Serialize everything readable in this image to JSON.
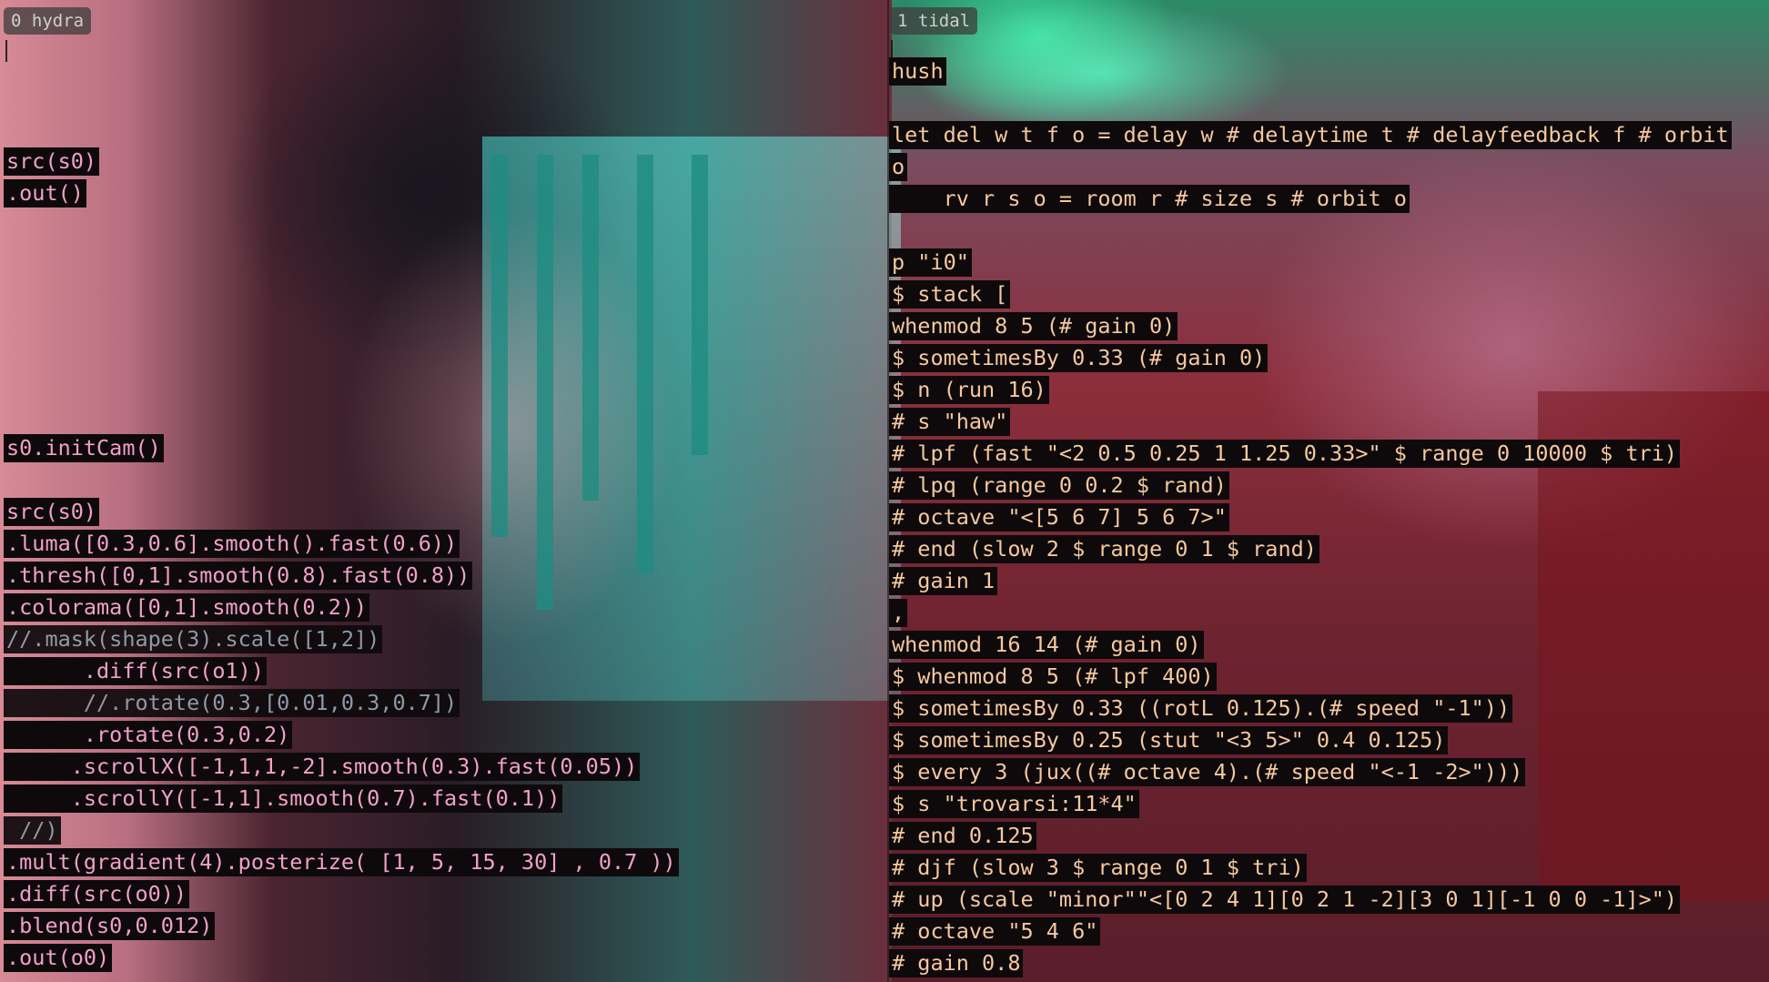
{
  "tabs": {
    "left": "0 hydra",
    "right": "1 tidal"
  },
  "colors": {
    "hydra_code": "#f2a0c8",
    "tidal_code": "#f6c89e",
    "comment": "#8f9aa6",
    "line_background": "#0e0a0c"
  },
  "hydra": {
    "lines": [
      "src(s0)",
      ".out()",
      "s0.initCam()",
      "src(s0)",
      ".luma([0.3,0.6].smooth().fast(0.6))",
      ".thresh([0,1].smooth(0.8).fast(0.8))",
      ".colorama([0,1].smooth(0.2))",
      "//.mask(shape(3).scale([1,2])",
      "      .diff(src(o1))",
      "      //.rotate(0.3,[0.01,0.3,0.7])",
      "      .rotate(0.3,0.2)",
      "     .scrollX([-1,1,1,-2].smooth(0.3).fast(0.05))",
      "     .scrollY([-1,1].smooth(0.7).fast(0.1))",
      " //)",
      ".mult(gradient(4).posterize( [1, 5, 15, 30] , 0.7 ))",
      ".diff(src(o0))",
      ".blend(s0,0.012)",
      ".out(o0)"
    ]
  },
  "tidal": {
    "lines": [
      "hush",
      "let del w t f o = delay w # delaytime t # delayfeedback f # orbit",
      "o",
      "    rv r s o = room r # size s # orbit o",
      "p \"i0\"",
      "$ stack [",
      "whenmod 8 5 (# gain 0)",
      "$ sometimesBy 0.33 (# gain 0)",
      "$ n (run 16)",
      "# s \"haw\"",
      "# lpf (fast \"<2 0.5 0.25 1 1.25 0.33>\" $ range 0 10000 $ tri)",
      "# lpq (range 0 0.2 $ rand)",
      "# octave \"<[5 6 7] 5 6 7>\"",
      "# end (slow 2 $ range 0 1 $ rand)",
      "# gain 1",
      ",",
      "whenmod 16 14 (# gain 0)",
      "$ whenmod 8 5 (# lpf 400)",
      "$ sometimesBy 0.33 ((rotL 0.125).(# speed \"-1\"))",
      "$ sometimesBy 0.25 (stut \"<3 5>\" 0.4 0.125)",
      "$ every 3 (jux((# octave 4).(# speed \"<-1 -2>\")))",
      "$ s \"trovarsi:11*4\"",
      "# end 0.125",
      "# djf (slow 3 $ range 0 1 $ tri)",
      "# up (scale \"minor\"\"<[0 2 4 1][0 2 1 -2][3 0 1][-1 0 0 -1]>\")",
      "# octave \"5 4 6\"",
      "# gain 0.8"
    ]
  }
}
